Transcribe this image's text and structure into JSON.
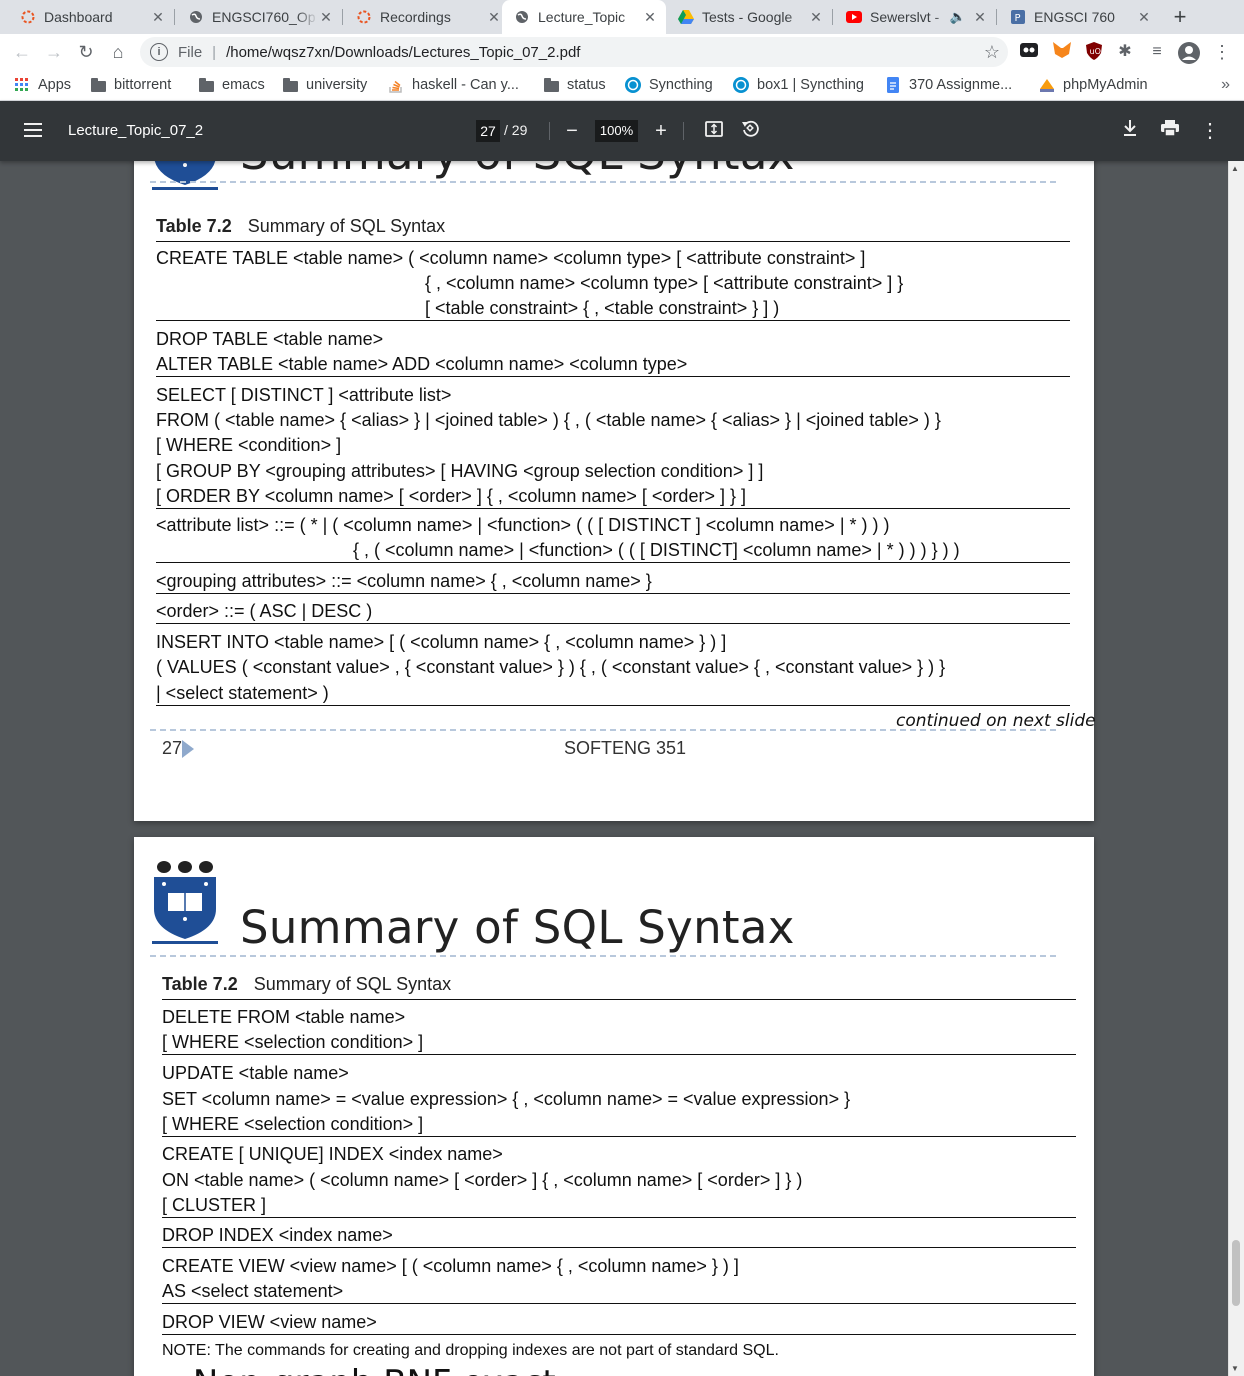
{
  "tabs": [
    {
      "title": "Dashboard",
      "icon": "ubuntu"
    },
    {
      "title": "ENGSCI760_Op",
      "icon": "globe"
    },
    {
      "title": "Recordings",
      "icon": "ubuntu"
    },
    {
      "title": "Lecture_Topic",
      "icon": "globe"
    },
    {
      "title": "Tests - Google",
      "icon": "drive"
    },
    {
      "title": "Sewerslvt -",
      "icon": "youtube"
    },
    {
      "title": "ENGSCI 760",
      "icon": "p"
    }
  ],
  "toolbar": {
    "scheme": "File",
    "divider": "|",
    "url": "/home/wqsz7xn/Downloads/Lectures_Topic_07_2.pdf"
  },
  "bookmarks": [
    {
      "label": "Apps"
    },
    {
      "label": "bittorrent"
    },
    {
      "label": "emacs"
    },
    {
      "label": "university"
    },
    {
      "label": "haskell - Can y..."
    },
    {
      "label": "status"
    },
    {
      "label": "Syncthing"
    },
    {
      "label": "box1 | Syncthing"
    },
    {
      "label": "370 Assignme..."
    },
    {
      "label": "phpMyAdmin"
    }
  ],
  "pdf": {
    "title": "Lecture_Topic_07_2",
    "page": "27",
    "page_sep": "/",
    "total": "29",
    "zoom": "100%"
  },
  "slide1": {
    "title": "Summary of SQL Syntax",
    "table_label": "Table 7.2",
    "table_title": "Summary of SQL Syntax",
    "lines": [
      "CREATE TABLE <table name> ( <column name> <column type> [ <attribute constraint> ]",
      "{ , <column name> <column type> [ <attribute constraint> ] }",
      "[ <table constraint> { , <table constraint> } ] )",
      "DROP TABLE <table name>",
      "ALTER TABLE <table name> ADD <column name> <column type>",
      "SELECT [ DISTINCT ] <attribute list>",
      "FROM ( <table name> { <alias> } | <joined table> ) { , ( <table name> { <alias> } | <joined table> ) }",
      "[ WHERE <condition> ]",
      "[ GROUP BY <grouping attributes> [ HAVING <group selection condition> ] ]",
      "[ ORDER BY <column name> [ <order> ] { , <column name> [ <order> ] } ]",
      "<attribute list> ::= ( * | ( <column name> | <function> ( ( [ DISTINCT ] <column name> | * ) ) )",
      "{ , ( <column name> | <function> ( ( [ DISTINCT] <column name> | * ) ) ) } ) )",
      "<grouping attributes> ::= <column name> { , <column name> }",
      "<order> ::= ( ASC | DESC )",
      "INSERT INTO <table name> [ ( <column name> { , <column name> } ) ]",
      "( VALUES ( <constant value> , { <constant value> } ) { , ( <constant value> { , <constant value> } ) }",
      "| <select statement> )"
    ],
    "continued": "continued on next slide",
    "page_number": "27",
    "course": "SOFTENG 351"
  },
  "slide2": {
    "title": "Summary of SQL Syntax",
    "table_label": "Table 7.2",
    "table_title": "Summary of SQL Syntax",
    "lines": [
      "DELETE FROM <table name>",
      "[ WHERE <selection condition> ]",
      "UPDATE <table name>",
      "SET <column name> = <value expression> { , <column name> = <value expression> }",
      "[ WHERE <selection condition> ]",
      "CREATE [ UNIQUE] INDEX <index name>",
      "ON <table name> ( <column name> [ <order> ] { , <column name> [ <order> ] } )",
      "[ CLUSTER ]",
      "DROP INDEX <index name>",
      "CREATE VIEW <view name> [ ( <column name> { , <column name> } ) ]",
      "AS <select statement>",
      "DROP VIEW <view name>"
    ],
    "note": "NOTE: The commands for creating and dropping indexes are not part of standard SQL.",
    "next_heading": "• Non-graph BNF exact"
  }
}
